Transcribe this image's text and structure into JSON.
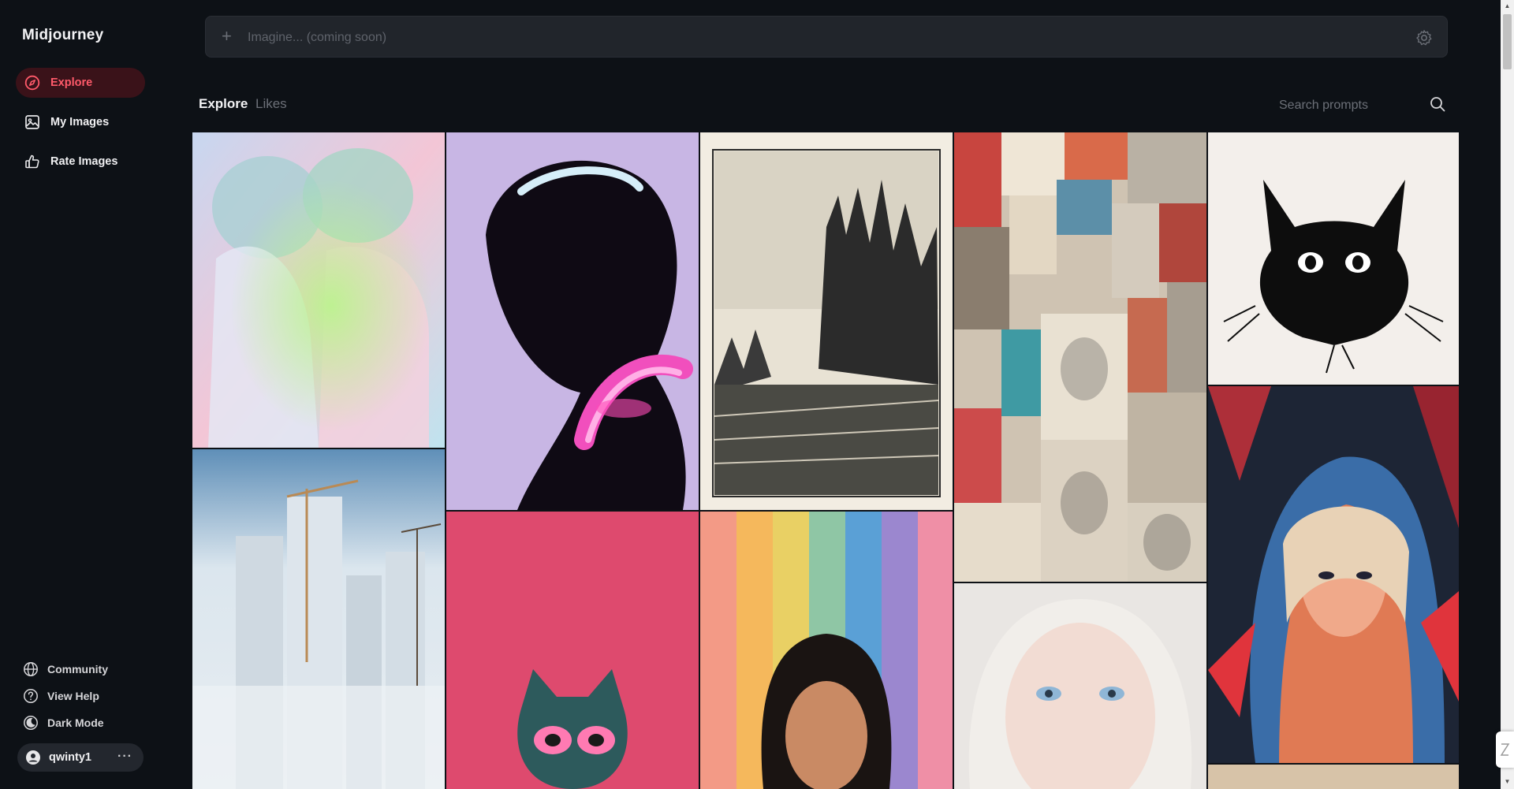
{
  "app": {
    "brand": "Midjourney"
  },
  "sidebar": {
    "items": [
      {
        "label": "Explore",
        "icon": "compass-icon",
        "active": true
      },
      {
        "label": "My Images",
        "icon": "image-icon",
        "active": false
      },
      {
        "label": "Rate Images",
        "icon": "thumbs-up-icon",
        "active": false
      }
    ],
    "bottom": [
      {
        "label": "Community",
        "icon": "globe-icon"
      },
      {
        "label": "View Help",
        "icon": "help-circle-icon"
      },
      {
        "label": "Dark Mode",
        "icon": "moon-icon"
      }
    ],
    "user": {
      "name": "qwinty1",
      "more": "···"
    }
  },
  "imagine": {
    "placeholder": "Imagine... (coming soon)",
    "plus": "+"
  },
  "tabs": [
    {
      "label": "Explore",
      "active": true
    },
    {
      "label": "Likes",
      "active": false
    }
  ],
  "search": {
    "placeholder": "Search prompts"
  },
  "gallery": {
    "tiles": [
      "pastel-twins-image",
      "black-chrome-figure-image",
      "forest-linocut-image",
      "faces-collage-image",
      "ink-black-cat-image",
      "frozen-city-image",
      "masked-cat-image",
      "rainbow-portrait-image",
      "blonde-woman-image",
      "hooded-girl-image",
      "partial-tile-image"
    ]
  },
  "colors": {
    "accent": "#ff5a6a",
    "accent_bg": "#3a1219",
    "background": "#0d1116",
    "input_bg": "#21252b"
  }
}
